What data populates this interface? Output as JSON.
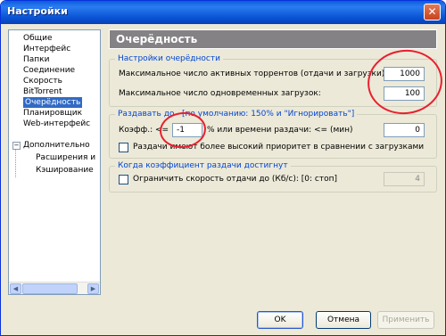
{
  "window": {
    "title": "Настройки",
    "close_glyph": "✕"
  },
  "tree": {
    "items": [
      "Общие",
      "Интерфейс",
      "Папки",
      "Соединение",
      "Скорость",
      "BitTorrent",
      "Очерёдность",
      "Планировщик",
      "Web-интерфейс",
      "Дополнительно"
    ],
    "sub_items": [
      "Расширения и",
      "Кэширование"
    ],
    "expander": "−",
    "selected_index": 6
  },
  "panel": {
    "title": "Очерёдность"
  },
  "queue_settings": {
    "legend": "Настройки очерёдности",
    "max_active_label": "Максимальное число активных торрентов (отдачи и загрузки):",
    "max_active_value": "1000",
    "max_downloads_label": "Максимальное число одновременных загрузок:",
    "max_downloads_value": "100"
  },
  "seed_settings": {
    "legend": "Раздавать до",
    "legend_default": "[по умолчанию: 150% и \"Игнорировать\"]",
    "ratio_label": "Коэфф.: <=",
    "ratio_value": "-1",
    "time_label": "% или времени раздачи: <= (мин)",
    "time_value": "0",
    "priority_label": "Раздачи имеют более высокий приоритет в сравнении с загрузками",
    "priority_checked": false
  },
  "limit_settings": {
    "legend": "Когда коэффициент раздачи достигнут",
    "limit_label": "Ограничить скорость отдачи до (Кб/с): [0: стоп]",
    "limit_value": "4",
    "limit_checked": false
  },
  "buttons": {
    "ok": "OK",
    "cancel": "Отмена",
    "apply": "Применить"
  },
  "annotation_color": "#e8202f"
}
